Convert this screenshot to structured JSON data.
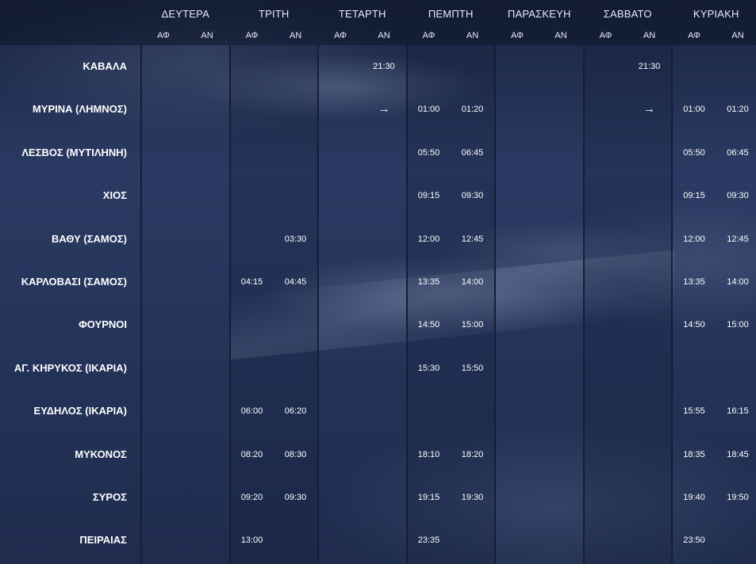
{
  "days": [
    {
      "name": "ΔΕΥΤΕΡΑ",
      "arr": "ΑΦ",
      "dep": "ΑΝ"
    },
    {
      "name": "ΤΡΙΤΗ",
      "arr": "ΑΦ",
      "dep": "ΑΝ"
    },
    {
      "name": "ΤΕΤΑΡΤΗ",
      "arr": "ΑΦ",
      "dep": "ΑΝ"
    },
    {
      "name": "ΠΕΜΠΤΗ",
      "arr": "ΑΦ",
      "dep": "ΑΝ"
    },
    {
      "name": "ΠΑΡΑΣΚΕΥΗ",
      "arr": "ΑΦ",
      "dep": "ΑΝ"
    },
    {
      "name": "ΣΑΒΒΑΤΟ",
      "arr": "ΑΦ",
      "dep": "ΑΝ"
    },
    {
      "name": "ΚΥΡΙΑΚΗ",
      "arr": "ΑΦ",
      "dep": "ΑΝ"
    }
  ],
  "ports": [
    {
      "name": "ΚΑΒΑΛΑ",
      "times": [
        [
          "",
          ""
        ],
        [
          "",
          ""
        ],
        [
          "",
          "21:30"
        ],
        [
          "",
          ""
        ],
        [
          "",
          ""
        ],
        [
          "",
          "21:30"
        ],
        [
          "",
          ""
        ]
      ]
    },
    {
      "name": "ΜΥΡΙΝΑ (ΛΗΜΝΟΣ)",
      "times": [
        [
          "",
          ""
        ],
        [
          "",
          ""
        ],
        [
          "",
          "→"
        ],
        [
          "01:00",
          "01:20"
        ],
        [
          "",
          ""
        ],
        [
          "",
          "→"
        ],
        [
          "01:00",
          "01:20"
        ]
      ]
    },
    {
      "name": "ΛΕΣΒΟΣ (ΜΥΤΙΛΗΝΗ)",
      "times": [
        [
          "",
          ""
        ],
        [
          "",
          ""
        ],
        [
          "",
          ""
        ],
        [
          "05:50",
          "06:45"
        ],
        [
          "",
          ""
        ],
        [
          "",
          ""
        ],
        [
          "05:50",
          "06:45"
        ]
      ]
    },
    {
      "name": "ΧΙΟΣ",
      "times": [
        [
          "",
          ""
        ],
        [
          "",
          ""
        ],
        [
          "",
          ""
        ],
        [
          "09:15",
          "09:30"
        ],
        [
          "",
          ""
        ],
        [
          "",
          ""
        ],
        [
          "09:15",
          "09:30"
        ]
      ]
    },
    {
      "name": "ΒΑΘΥ (ΣΑΜΟΣ)",
      "times": [
        [
          "",
          ""
        ],
        [
          "",
          "03:30"
        ],
        [
          "",
          ""
        ],
        [
          "12:00",
          "12:45"
        ],
        [
          "",
          ""
        ],
        [
          "",
          ""
        ],
        [
          "12:00",
          "12:45"
        ]
      ]
    },
    {
      "name": "ΚΑΡΛΟΒΑΣΙ (ΣΑΜΟΣ)",
      "times": [
        [
          "",
          ""
        ],
        [
          "04:15",
          "04:45"
        ],
        [
          "",
          ""
        ],
        [
          "13:35",
          "14:00"
        ],
        [
          "",
          ""
        ],
        [
          "",
          ""
        ],
        [
          "13:35",
          "14:00"
        ]
      ]
    },
    {
      "name": "ΦΟΥΡΝΟΙ",
      "times": [
        [
          "",
          ""
        ],
        [
          "",
          ""
        ],
        [
          "",
          ""
        ],
        [
          "14:50",
          "15:00"
        ],
        [
          "",
          ""
        ],
        [
          "",
          ""
        ],
        [
          "14:50",
          "15:00"
        ]
      ]
    },
    {
      "name": "ΑΓ. ΚΗΡΥΚΟΣ (ΙΚΑΡΙΑ)",
      "times": [
        [
          "",
          ""
        ],
        [
          "",
          ""
        ],
        [
          "",
          ""
        ],
        [
          "15:30",
          "15:50"
        ],
        [
          "",
          ""
        ],
        [
          "",
          ""
        ],
        [
          "",
          ""
        ]
      ]
    },
    {
      "name": "ΕΥΔΗΛΟΣ (ΙΚΑΡΙΑ)",
      "times": [
        [
          "",
          ""
        ],
        [
          "06:00",
          "06:20"
        ],
        [
          "",
          ""
        ],
        [
          "",
          ""
        ],
        [
          "",
          ""
        ],
        [
          "",
          ""
        ],
        [
          "15:55",
          "16:15"
        ]
      ]
    },
    {
      "name": "ΜΥΚΟΝΟΣ",
      "times": [
        [
          "",
          ""
        ],
        [
          "08:20",
          "08:30"
        ],
        [
          "",
          ""
        ],
        [
          "18:10",
          "18:20"
        ],
        [
          "",
          ""
        ],
        [
          "",
          ""
        ],
        [
          "18:35",
          "18:45"
        ]
      ]
    },
    {
      "name": "ΣΥΡΟΣ",
      "times": [
        [
          "",
          ""
        ],
        [
          "09:20",
          "09:30"
        ],
        [
          "",
          ""
        ],
        [
          "19:15",
          "19:30"
        ],
        [
          "",
          ""
        ],
        [
          "",
          ""
        ],
        [
          "19:40",
          "19:50"
        ]
      ]
    },
    {
      "name": "ΠΕΙΡΑΙΑΣ",
      "times": [
        [
          "",
          ""
        ],
        [
          "13:00",
          ""
        ],
        [
          "",
          ""
        ],
        [
          "23:35",
          ""
        ],
        [
          "",
          ""
        ],
        [
          "",
          ""
        ],
        [
          "23:50",
          ""
        ]
      ]
    }
  ]
}
